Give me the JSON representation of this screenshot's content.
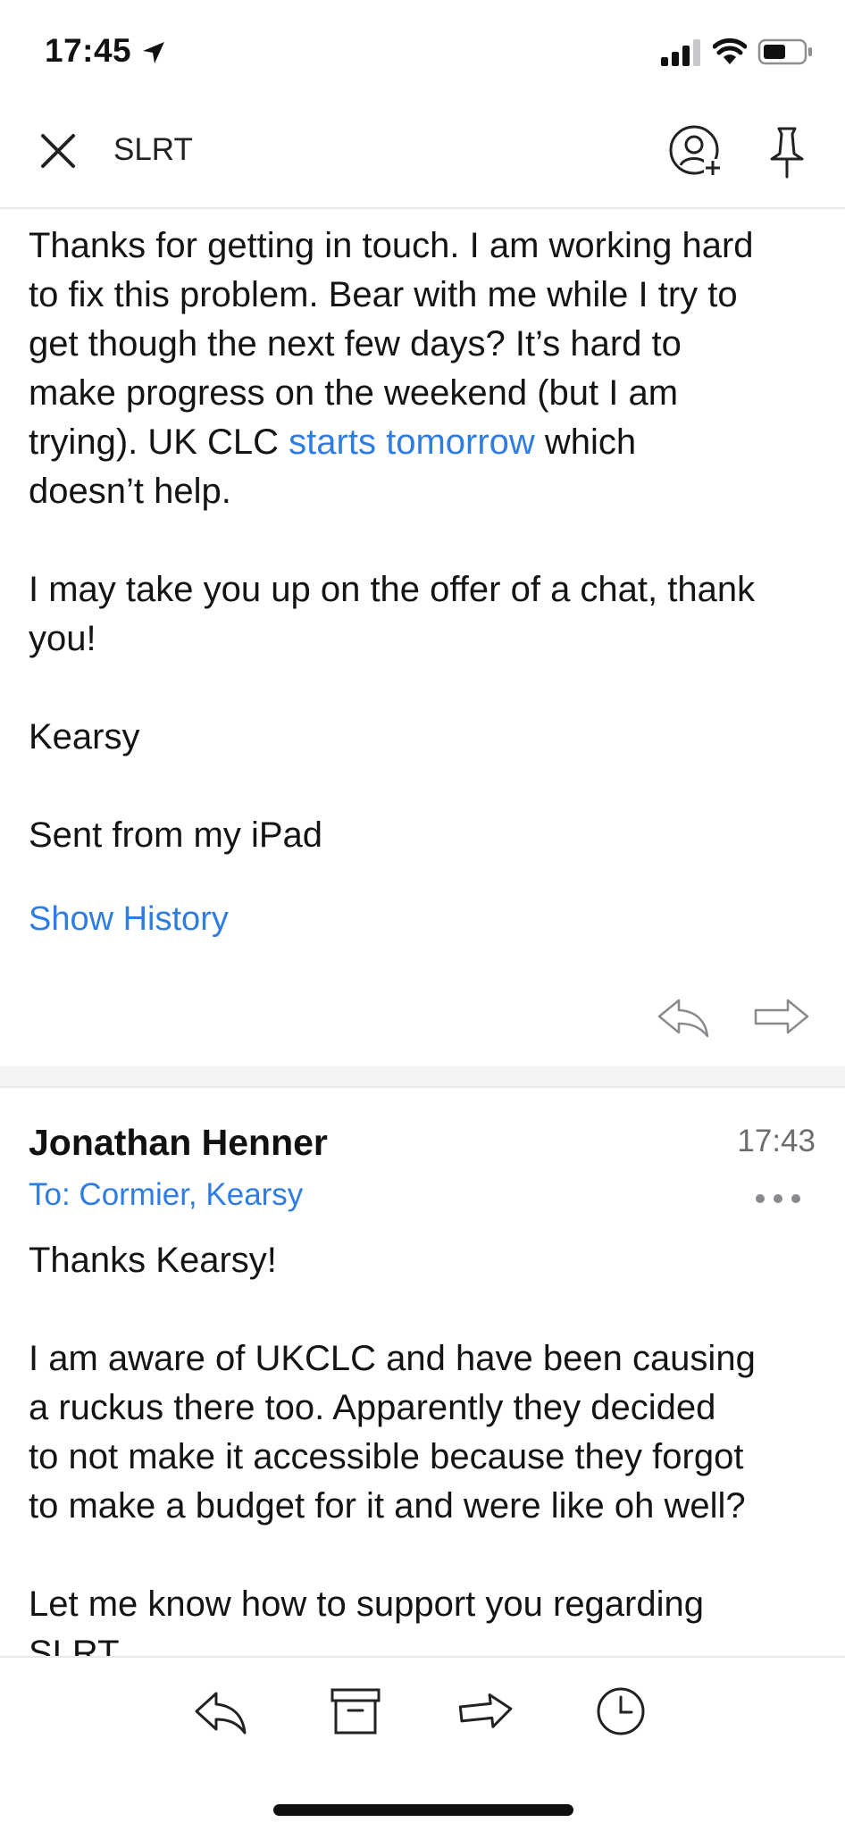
{
  "status_bar": {
    "time": "17:45"
  },
  "nav": {
    "title": "SLRT"
  },
  "message1": {
    "line1": "Thanks for getting in touch. I am working hard",
    "line2": "to fix this problem.  Bear with me while I try to",
    "line3": "get though the next few days? It’s hard to",
    "line4": "make progress on the weekend (but I am",
    "line5_before": "trying). UK CLC ",
    "line5_link": "starts tomorrow",
    "line5_after": " which",
    "line6": "doesn’t help.",
    "para2_line1": "I may take you up on the offer of a chat, thank",
    "para2_line2": "you!",
    "signature": "Kearsy",
    "sent_from": "Sent from my iPad",
    "show_history": "Show History"
  },
  "message2": {
    "sender": "Jonathan Henner",
    "time": "17:43",
    "to": "To: Cormier, Kearsy",
    "greeting": "Thanks Kearsy!",
    "para1_line1": "I am aware of UKCLC and have been causing",
    "para1_line2": "a ruckus there too. Apparently they decided",
    "para1_line3": "to not make it accessible because they forgot",
    "para1_line4": "to make a budget for it and were like oh well?",
    "para2_line1": "Let me know how to support you regarding",
    "para2_line2": "SLRT"
  },
  "icons": {
    "close": "close-icon",
    "add_person": "add-person-icon",
    "pin": "pin-icon",
    "reply": "reply-icon",
    "forward": "forward-icon",
    "archive": "archive-icon",
    "snooze": "clock-icon",
    "more": "more-icon"
  },
  "colors": {
    "link": "#2f7de1",
    "time_gray": "#6d6d72",
    "separator": "#f3f4f6"
  }
}
